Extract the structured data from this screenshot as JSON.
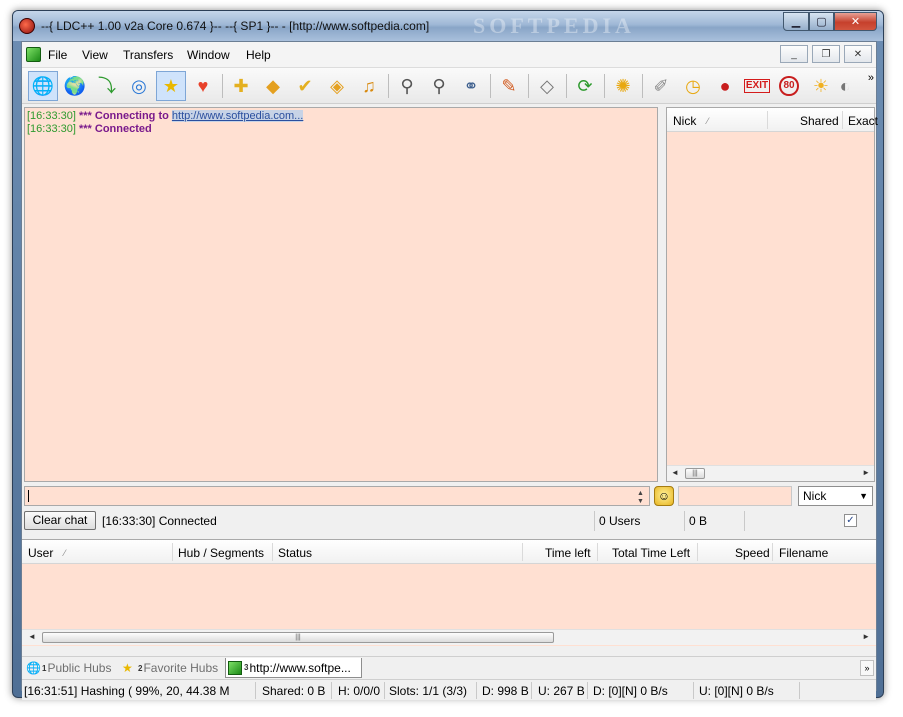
{
  "window": {
    "title": "--{ LDC++ 1.00 v2a Core 0.674 }--  --{  SP1 }-- - [http://www.softpedia.com]",
    "watermark": "SOFTPEDIA"
  },
  "menu": {
    "items": [
      "File",
      "View",
      "Transfers",
      "Window",
      "Help"
    ]
  },
  "toolbar": {
    "icons": [
      "public-hubs-icon",
      "reconnect-icon",
      "follow-redirect-icon",
      "network-icon",
      "favorite-hubs-icon",
      "favorite-users-icon",
      "add-share-icon",
      "download-queue-icon",
      "finished-downloads-icon",
      "upload-queue-icon",
      "finished-uploads-icon",
      "search-icon",
      "adl-search-icon",
      "search-spy-icon",
      "open-file-list-icon",
      "recents-icon",
      "refresh-icon",
      "settings-icon",
      "notepad-icon",
      "clock-icon",
      "record-icon",
      "exit-icon",
      "speed-limit-icon",
      "weather-icon",
      "overflow-icon"
    ]
  },
  "chat": {
    "lines": [
      {
        "time": "[16:33:30]",
        "text": "*** Connecting to ",
        "link": "http://www.softpedia.com..."
      },
      {
        "time": "[16:33:30]",
        "text": "*** Connected",
        "link": ""
      }
    ]
  },
  "userlist": {
    "columns": [
      "Nick",
      "Shared",
      "Exact"
    ]
  },
  "input": {
    "nick_filter": "Nick"
  },
  "statusrow": {
    "clear_label": "Clear chat",
    "message": "[16:33:30] Connected",
    "users": "0 Users",
    "shared": "0 B",
    "checkbox_mark": "✓"
  },
  "transfers": {
    "columns": [
      "User",
      "Hub / Segments",
      "Status",
      "Time left",
      "Total Time Left",
      "Speed",
      "Filename"
    ]
  },
  "tabs": [
    {
      "num": "1",
      "label": "Public Hubs"
    },
    {
      "num": "2",
      "label": "Favorite Hubs"
    },
    {
      "num": "3",
      "label": "http://www.softpe..."
    }
  ],
  "statusbar": {
    "hashing": "[16:31:51] Hashing ( 99%, 20, 44.38 M",
    "shared": "Shared: 0 B",
    "hubs": "H: 0/0/0",
    "slots": "Slots: 1/1 (3/3)",
    "downloaded": "D: 998 B",
    "uploaded": "U: 267 B",
    "down_speed": "D: [0][N] 0 B/s",
    "up_speed": "U: [0][N] 0 B/s"
  },
  "colors": {
    "pane_bg": "#ffe0d2",
    "timestamp": "#2f9a2f",
    "system_msg": "#7a1a8c",
    "link": "#2b4f9e"
  }
}
